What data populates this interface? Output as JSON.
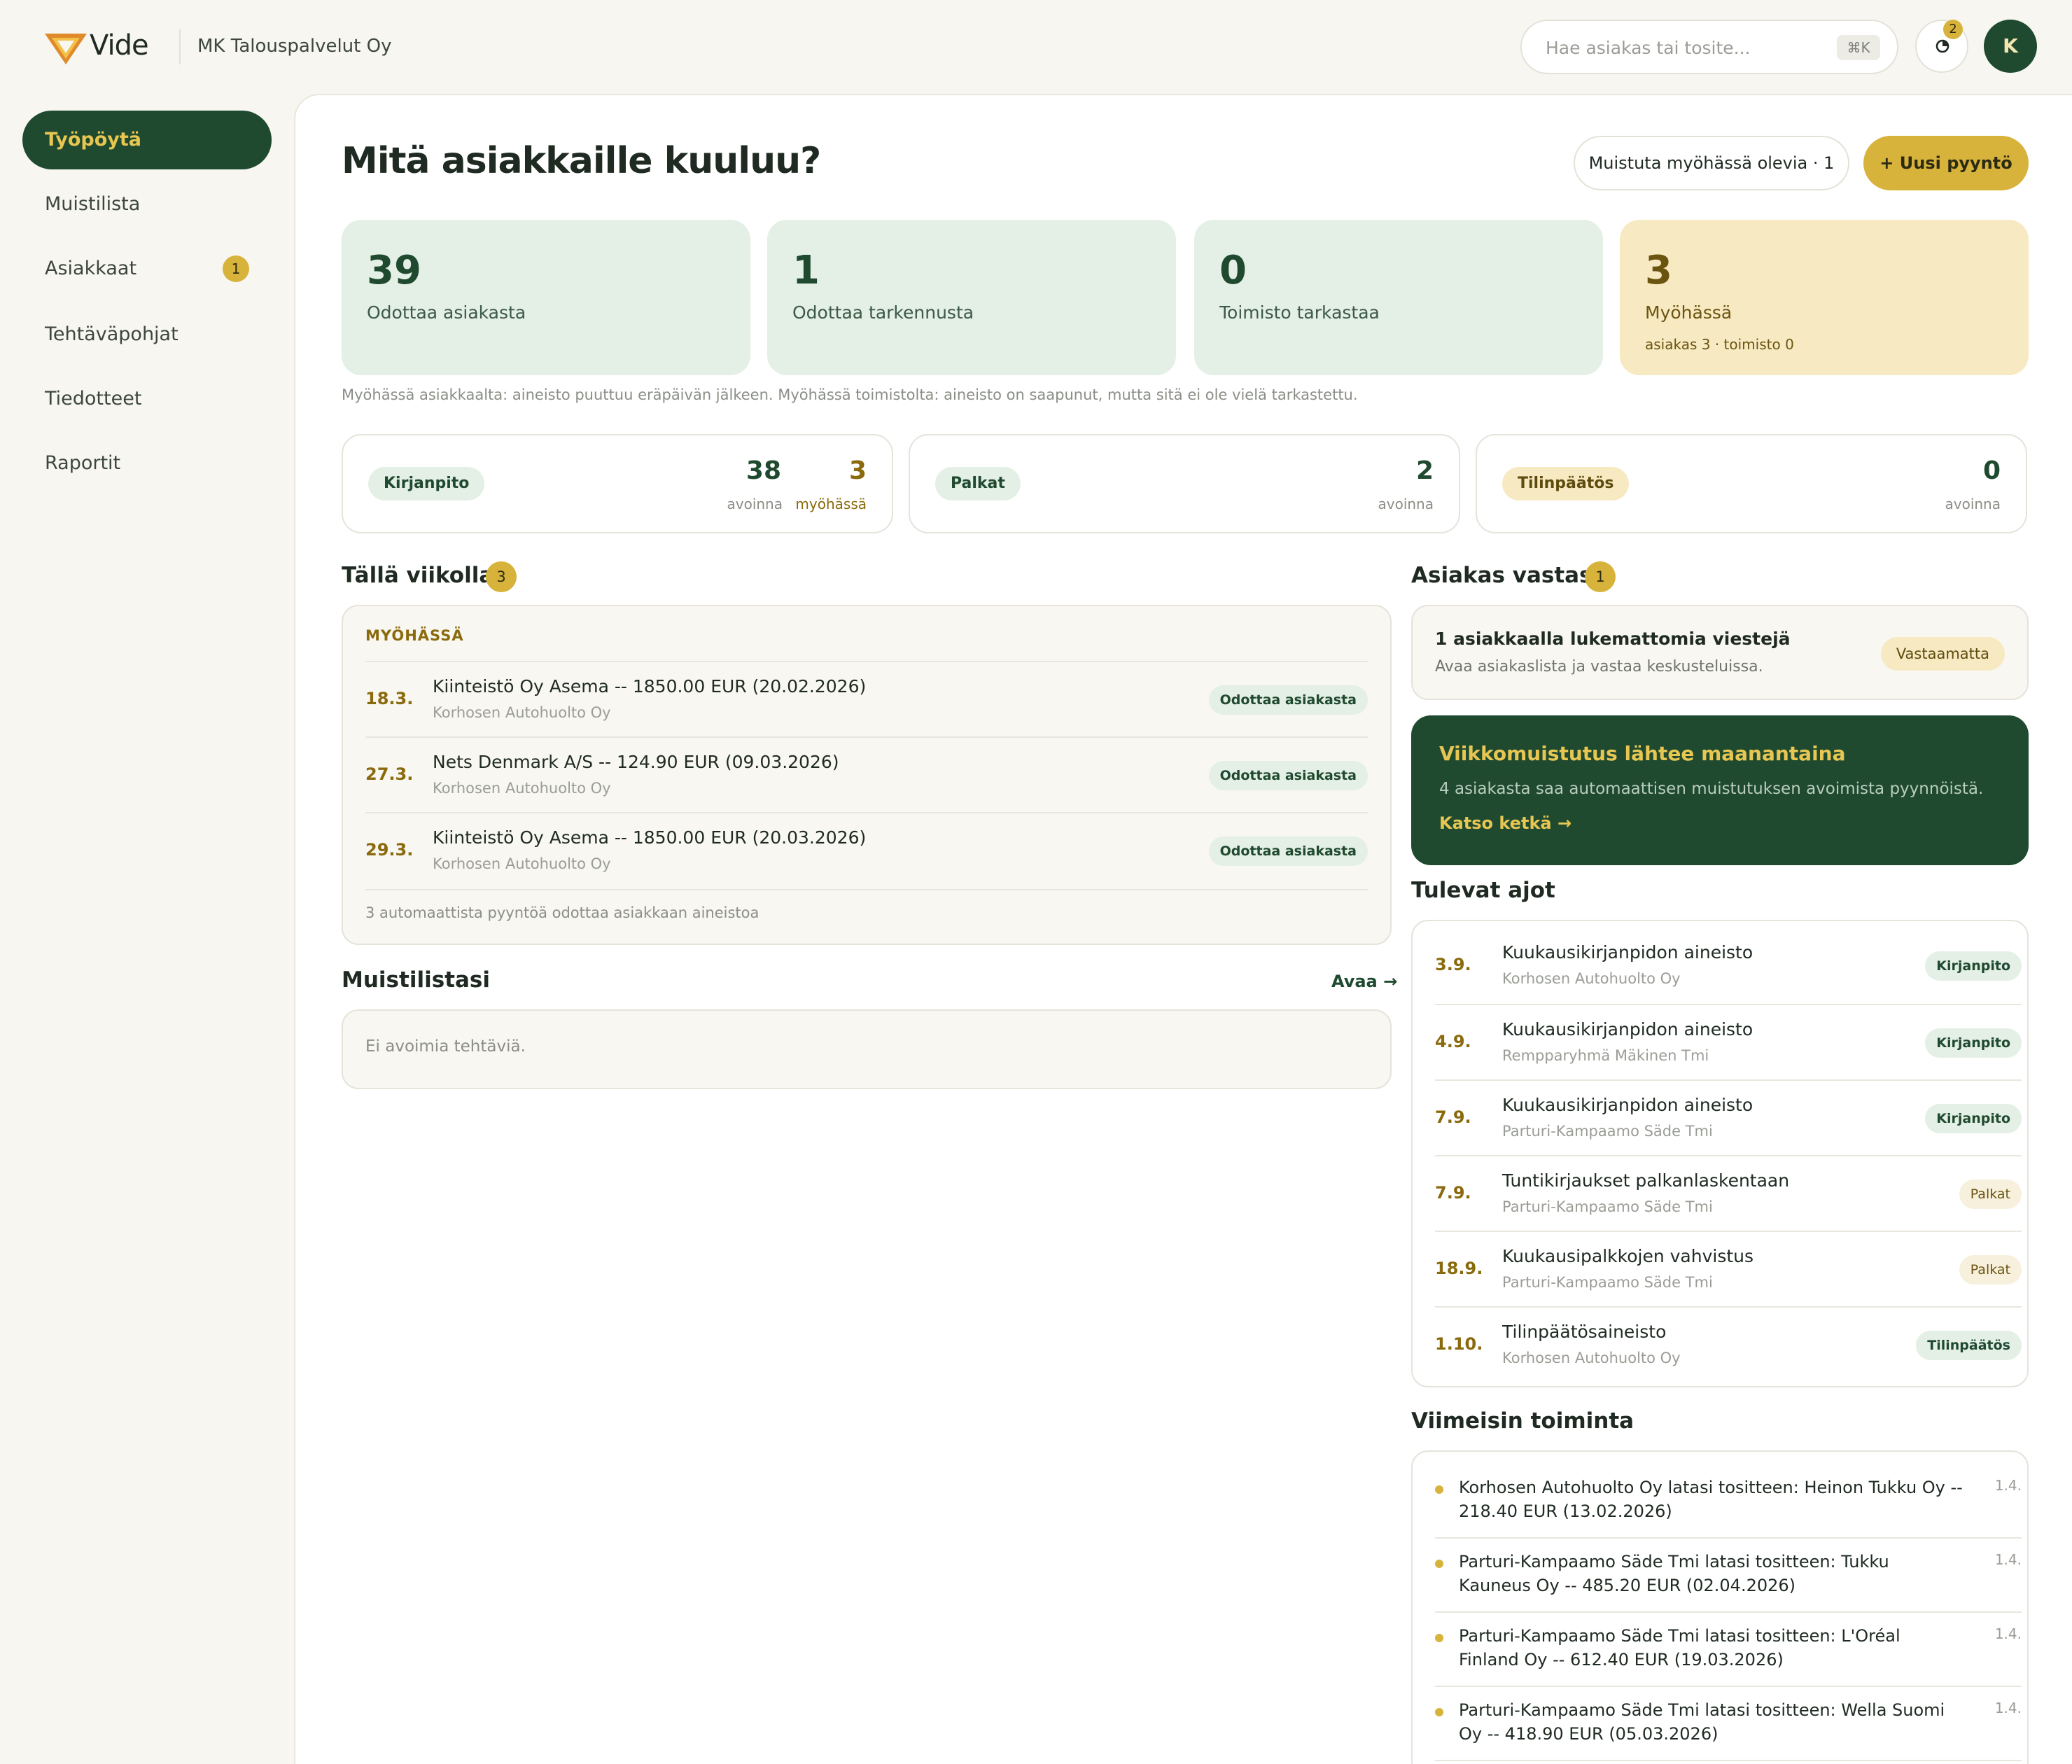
{
  "header": {
    "logo_text": "Vide",
    "org_name": "MK Talouspalvelut Oy",
    "search_placeholder": "Hae asiakas tai tosite...",
    "search_shortcut": "⌘K",
    "notification_count": "2",
    "avatar_initial": "K"
  },
  "sidebar": {
    "items": [
      {
        "label": "Työpöytä"
      },
      {
        "label": "Muistilista"
      },
      {
        "label": "Asiakkaat",
        "badge": "1"
      },
      {
        "label": "Tehtäväpohjat"
      },
      {
        "label": "Tiedotteet"
      },
      {
        "label": "Raportit"
      }
    ]
  },
  "main": {
    "title": "Mitä asiakkaille kuuluu?",
    "remind_button": "Muistuta myöhässä olevia · 1",
    "new_request_button": "+ Uusi pyyntö",
    "stats": [
      {
        "value": "39",
        "label": "Odottaa asiakasta"
      },
      {
        "value": "1",
        "label": "Odottaa tarkennusta"
      },
      {
        "value": "0",
        "label": "Toimisto tarkastaa"
      },
      {
        "value": "3",
        "label": "Myöhässä",
        "sub": "asiakas 3 · toimisto 0"
      }
    ],
    "note": "Myöhässä asiakkaalta: aineisto puuttuu eräpäivän jälkeen. Myöhässä toimistolta: aineisto on saapunut, mutta sitä ei ole vielä tarkastettu.",
    "categories": [
      {
        "name": "Kirjanpito",
        "open": "38",
        "open_label": "avoinna",
        "late": "3",
        "late_label": "myöhässä"
      },
      {
        "name": "Palkat",
        "open": "2",
        "open_label": "avoinna"
      },
      {
        "name": "Tilinpäätös",
        "open": "0",
        "open_label": "avoinna"
      }
    ],
    "this_week": {
      "title": "Tällä viikolla",
      "count": "3",
      "overdue_label": "MYÖHÄSSÄ",
      "rows": [
        {
          "date": "18.3.",
          "title": "Kiinteistö Oy Asema -- 1850.00 EUR (20.02.2026)",
          "client": "Korhosen Autohuolto Oy",
          "status": "Odottaa asiakasta"
        },
        {
          "date": "27.3.",
          "title": "Nets Denmark A/S -- 124.90 EUR (09.03.2026)",
          "client": "Korhosen Autohuolto Oy",
          "status": "Odottaa asiakasta"
        },
        {
          "date": "29.3.",
          "title": "Kiinteistö Oy Asema -- 1850.00 EUR (20.03.2026)",
          "client": "Korhosen Autohuolto Oy",
          "status": "Odottaa asiakasta"
        }
      ],
      "footer": "3 automaattista pyyntöä odottaa asiakkaan aineistoa"
    },
    "notes": {
      "title": "Muistilistasi",
      "open_link": "Avaa →",
      "empty": "Ei avoimia tehtäviä."
    }
  },
  "right": {
    "replied": {
      "title": "Asiakas vastasi",
      "count": "1",
      "heading": "1 asiakkaalla lukemattomia viestejä",
      "text": "Avaa asiakaslista ja vastaa keskusteluissa.",
      "tag": "Vastaamatta"
    },
    "promo": {
      "heading": "Viikkomuistutus lähtee maanantaina",
      "text": "4 asiakasta saa automaattisen muistutuksen avoimista pyynnöistä.",
      "link": "Katso ketkä →"
    },
    "upcoming": {
      "title": "Tulevat ajot",
      "rows": [
        {
          "date": "3.9.",
          "title": "Kuukausikirjanpidon aineisto",
          "client": "Korhosen Autohuolto Oy",
          "tag": "Kirjanpito"
        },
        {
          "date": "4.9.",
          "title": "Kuukausikirjanpidon aineisto",
          "client": "Rempparyhmä Mäkinen Tmi",
          "tag": "Kirjanpito"
        },
        {
          "date": "7.9.",
          "title": "Kuukausikirjanpidon aineisto",
          "client": "Parturi-Kampaamo Säde Tmi",
          "tag": "Kirjanpito"
        },
        {
          "date": "7.9.",
          "title": "Tuntikirjaukset palkanlaskentaan",
          "client": "Parturi-Kampaamo Säde Tmi",
          "tag": "Palkat"
        },
        {
          "date": "18.9.",
          "title": "Kuukausipalkkojen vahvistus",
          "client": "Parturi-Kampaamo Säde Tmi",
          "tag": "Palkat"
        },
        {
          "date": "1.10.",
          "title": "Tilinpäätösaineisto",
          "client": "Korhosen Autohuolto Oy",
          "tag": "Tilinpäätös"
        }
      ]
    },
    "activity": {
      "title": "Viimeisin toiminta",
      "rows": [
        {
          "text": "Korhosen Autohuolto Oy latasi tositteen: Heinon Tukku Oy -- 218.40 EUR (13.02.2026)",
          "date": "1.4."
        },
        {
          "text": "Parturi-Kampaamo Säde Tmi latasi tositteen: Tukku Kauneus Oy -- 485.20 EUR (02.04.2026)",
          "date": "1.4."
        },
        {
          "text": "Parturi-Kampaamo Säde Tmi latasi tositteen: L'Oréal Finland Oy -- 612.40 EUR (19.03.2026)",
          "date": "1.4."
        },
        {
          "text": "Parturi-Kampaamo Säde Tmi latasi tositteen: Wella Suomi Oy -- 418.90 EUR (05.03.2026)",
          "date": "1.4."
        }
      ]
    }
  },
  "colors": {
    "brand_green": "#1f4a2f",
    "accent_gold": "#d8b33b",
    "stat_green": "#e4efe5",
    "stat_warn": "#f7eac2",
    "page_bg": "#f7f6f1"
  },
  "icons": [
    "vide-logo",
    "refresh-icon"
  ]
}
